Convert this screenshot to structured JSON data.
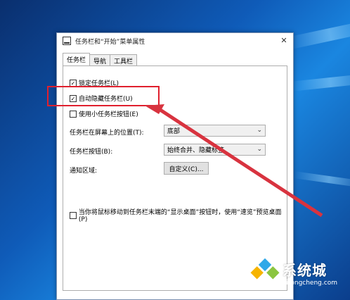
{
  "window": {
    "title": "任务栏和“开始”菜单属性",
    "close": "✕"
  },
  "tabs": [
    {
      "label": "任务栏",
      "active": true
    },
    {
      "label": "导航",
      "active": false
    },
    {
      "label": "工具栏",
      "active": false
    }
  ],
  "options": {
    "lock_taskbar": {
      "label": "锁定任务栏(L)",
      "checked": true
    },
    "auto_hide": {
      "label": "自动隐藏任务栏(U)",
      "checked": true
    },
    "small_buttons": {
      "label": "使用小任务栏按钮(E)",
      "checked": false
    }
  },
  "position": {
    "label": "任务栏在屏幕上的位置(T):",
    "value": "底部"
  },
  "buttons": {
    "label": "任务栏按钮(B):",
    "value": "始终合并、隐藏标签"
  },
  "notification": {
    "label": "通知区域:",
    "button": "自定义(C)..."
  },
  "peek": {
    "label": "当你将鼠标移动到任务栏末端的“显示桌面”按钮时，使用“速览”预览桌面(P)",
    "checked": false
  },
  "watermark": {
    "cn": "系统城",
    "url": "xitongcheng.com"
  },
  "colors": {
    "highlight": "#e0202e",
    "arrow": "#d8333f"
  }
}
